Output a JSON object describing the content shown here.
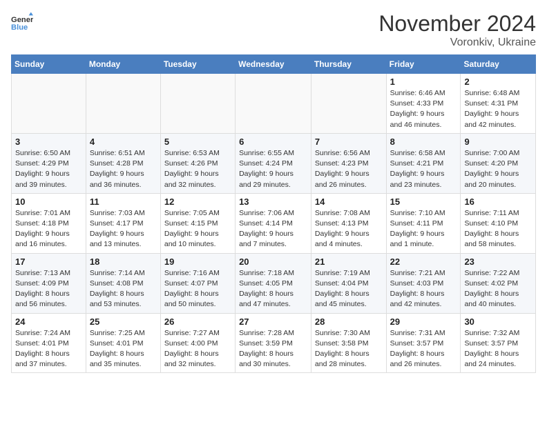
{
  "header": {
    "logo_general": "General",
    "logo_blue": "Blue",
    "month_title": "November 2024",
    "location": "Voronkiv, Ukraine"
  },
  "days_of_week": [
    "Sunday",
    "Monday",
    "Tuesday",
    "Wednesday",
    "Thursday",
    "Friday",
    "Saturday"
  ],
  "weeks": [
    [
      {
        "day": "",
        "info": ""
      },
      {
        "day": "",
        "info": ""
      },
      {
        "day": "",
        "info": ""
      },
      {
        "day": "",
        "info": ""
      },
      {
        "day": "",
        "info": ""
      },
      {
        "day": "1",
        "info": "Sunrise: 6:46 AM\nSunset: 4:33 PM\nDaylight: 9 hours\nand 46 minutes."
      },
      {
        "day": "2",
        "info": "Sunrise: 6:48 AM\nSunset: 4:31 PM\nDaylight: 9 hours\nand 42 minutes."
      }
    ],
    [
      {
        "day": "3",
        "info": "Sunrise: 6:50 AM\nSunset: 4:29 PM\nDaylight: 9 hours\nand 39 minutes."
      },
      {
        "day": "4",
        "info": "Sunrise: 6:51 AM\nSunset: 4:28 PM\nDaylight: 9 hours\nand 36 minutes."
      },
      {
        "day": "5",
        "info": "Sunrise: 6:53 AM\nSunset: 4:26 PM\nDaylight: 9 hours\nand 32 minutes."
      },
      {
        "day": "6",
        "info": "Sunrise: 6:55 AM\nSunset: 4:24 PM\nDaylight: 9 hours\nand 29 minutes."
      },
      {
        "day": "7",
        "info": "Sunrise: 6:56 AM\nSunset: 4:23 PM\nDaylight: 9 hours\nand 26 minutes."
      },
      {
        "day": "8",
        "info": "Sunrise: 6:58 AM\nSunset: 4:21 PM\nDaylight: 9 hours\nand 23 minutes."
      },
      {
        "day": "9",
        "info": "Sunrise: 7:00 AM\nSunset: 4:20 PM\nDaylight: 9 hours\nand 20 minutes."
      }
    ],
    [
      {
        "day": "10",
        "info": "Sunrise: 7:01 AM\nSunset: 4:18 PM\nDaylight: 9 hours\nand 16 minutes."
      },
      {
        "day": "11",
        "info": "Sunrise: 7:03 AM\nSunset: 4:17 PM\nDaylight: 9 hours\nand 13 minutes."
      },
      {
        "day": "12",
        "info": "Sunrise: 7:05 AM\nSunset: 4:15 PM\nDaylight: 9 hours\nand 10 minutes."
      },
      {
        "day": "13",
        "info": "Sunrise: 7:06 AM\nSunset: 4:14 PM\nDaylight: 9 hours\nand 7 minutes."
      },
      {
        "day": "14",
        "info": "Sunrise: 7:08 AM\nSunset: 4:13 PM\nDaylight: 9 hours\nand 4 minutes."
      },
      {
        "day": "15",
        "info": "Sunrise: 7:10 AM\nSunset: 4:11 PM\nDaylight: 9 hours\nand 1 minute."
      },
      {
        "day": "16",
        "info": "Sunrise: 7:11 AM\nSunset: 4:10 PM\nDaylight: 8 hours\nand 58 minutes."
      }
    ],
    [
      {
        "day": "17",
        "info": "Sunrise: 7:13 AM\nSunset: 4:09 PM\nDaylight: 8 hours\nand 56 minutes."
      },
      {
        "day": "18",
        "info": "Sunrise: 7:14 AM\nSunset: 4:08 PM\nDaylight: 8 hours\nand 53 minutes."
      },
      {
        "day": "19",
        "info": "Sunrise: 7:16 AM\nSunset: 4:07 PM\nDaylight: 8 hours\nand 50 minutes."
      },
      {
        "day": "20",
        "info": "Sunrise: 7:18 AM\nSunset: 4:05 PM\nDaylight: 8 hours\nand 47 minutes."
      },
      {
        "day": "21",
        "info": "Sunrise: 7:19 AM\nSunset: 4:04 PM\nDaylight: 8 hours\nand 45 minutes."
      },
      {
        "day": "22",
        "info": "Sunrise: 7:21 AM\nSunset: 4:03 PM\nDaylight: 8 hours\nand 42 minutes."
      },
      {
        "day": "23",
        "info": "Sunrise: 7:22 AM\nSunset: 4:02 PM\nDaylight: 8 hours\nand 40 minutes."
      }
    ],
    [
      {
        "day": "24",
        "info": "Sunrise: 7:24 AM\nSunset: 4:01 PM\nDaylight: 8 hours\nand 37 minutes."
      },
      {
        "day": "25",
        "info": "Sunrise: 7:25 AM\nSunset: 4:01 PM\nDaylight: 8 hours\nand 35 minutes."
      },
      {
        "day": "26",
        "info": "Sunrise: 7:27 AM\nSunset: 4:00 PM\nDaylight: 8 hours\nand 32 minutes."
      },
      {
        "day": "27",
        "info": "Sunrise: 7:28 AM\nSunset: 3:59 PM\nDaylight: 8 hours\nand 30 minutes."
      },
      {
        "day": "28",
        "info": "Sunrise: 7:30 AM\nSunset: 3:58 PM\nDaylight: 8 hours\nand 28 minutes."
      },
      {
        "day": "29",
        "info": "Sunrise: 7:31 AM\nSunset: 3:57 PM\nDaylight: 8 hours\nand 26 minutes."
      },
      {
        "day": "30",
        "info": "Sunrise: 7:32 AM\nSunset: 3:57 PM\nDaylight: 8 hours\nand 24 minutes."
      }
    ]
  ]
}
